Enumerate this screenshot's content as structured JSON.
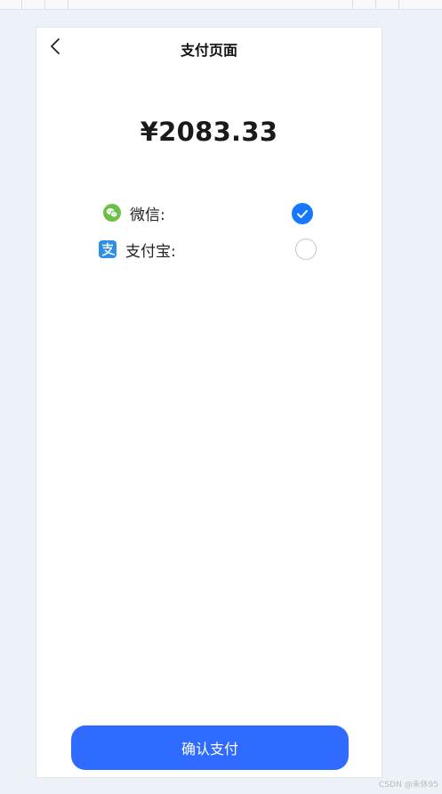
{
  "header": {
    "title": "支付页面"
  },
  "amount": {
    "text": "¥2083.33"
  },
  "methods": [
    {
      "label": "微信:",
      "icon": "wechat-icon",
      "selected": true,
      "color": "#6cc04a"
    },
    {
      "label": "支付宝:",
      "icon": "alipay-icon",
      "selected": false,
      "color": "#2f8fe7"
    }
  ],
  "confirm": {
    "label": "确认支付"
  },
  "watermark": "CSDN @未休95",
  "colors": {
    "accent": "#1677ff",
    "button": "#2f6bff",
    "background": "#edf1f8"
  }
}
